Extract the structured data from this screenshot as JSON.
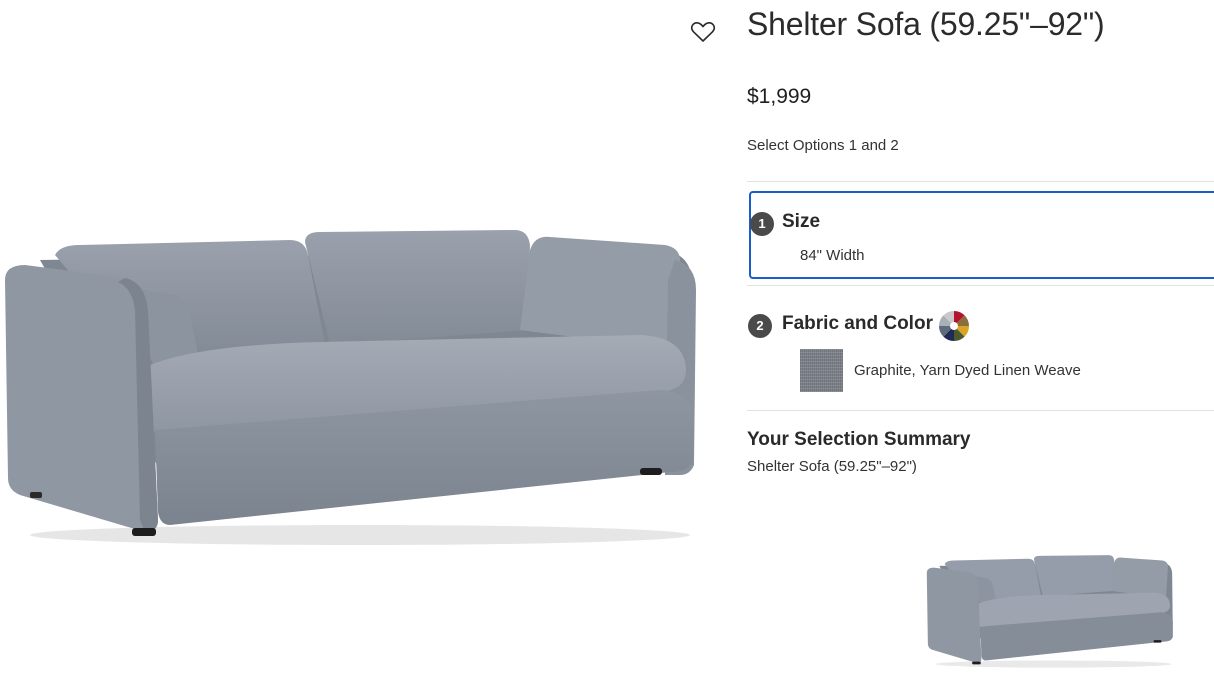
{
  "product": {
    "title": "Shelter Sofa (59.25\"–92\")",
    "price": "$1,999",
    "select_note": "Select Options 1 and 2"
  },
  "options": {
    "size": {
      "step": "1",
      "title": "Size",
      "value": "84\" Width"
    },
    "fabric": {
      "step": "2",
      "title": "Fabric and Color",
      "value": "Graphite, Yarn Dyed Linen Weave"
    }
  },
  "summary": {
    "title": "Your Selection Summary",
    "text": "Shelter Sofa (59.25\"–92\")"
  },
  "icons": {
    "favorite": "heart-outline-icon",
    "color_wheel": "color-wheel-icon"
  },
  "colors": {
    "accent_border": "#1a5fc7",
    "step_badge": "#4a4a4a",
    "sofa_fabric": "#8e96a1"
  }
}
